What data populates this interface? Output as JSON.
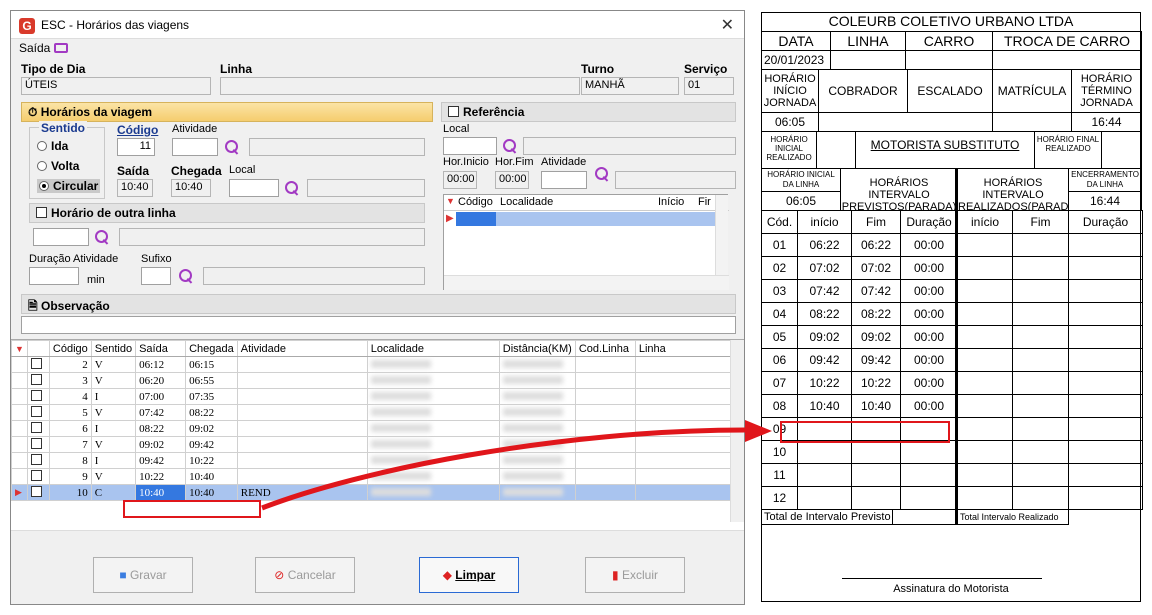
{
  "window": {
    "title": "ESC - Horários das viagens",
    "menu_label": "Saída",
    "close_glyph": "✕"
  },
  "header": {
    "tipo_dia_label": "Tipo de Dia",
    "tipo_dia_value": "ÚTEIS",
    "linha_label": "Linha",
    "linha_value": "",
    "turno_label": "Turno",
    "turno_value": "MANHÃ",
    "servico_label": "Serviço",
    "servico_value": "01"
  },
  "horarios": {
    "section_label": "Horários da viagem",
    "sentido_label": "Sentido",
    "options": [
      "Ida",
      "Volta",
      "Circular"
    ],
    "selected_option": "Circular",
    "codigo_label": "Código",
    "codigo_value": "11",
    "atividade_label": "Atividade",
    "saida_label": "Saída",
    "saida_value": "10:40",
    "chegada_label": "Chegada",
    "chegada_value": "10:40",
    "local_label": "Local"
  },
  "outra_linha": {
    "label": "Horário de outra linha",
    "duracao_label": "Duração Atividade",
    "min_label": "min",
    "sufixo_label": "Sufixo"
  },
  "referencia": {
    "label": "Referência",
    "local_label": "Local",
    "hor_inicio_label": "Hor.Inicio",
    "hor_inicio_value": "00:00",
    "hor_fim_label": "Hor.Fim",
    "hor_fim_value": "00:00",
    "atividade_label": "Atividade",
    "columns": [
      "Código",
      "Localidade",
      "Início",
      "Fir"
    ]
  },
  "observacao_label": "Observação",
  "grid": {
    "columns": [
      "Código",
      "Sentido",
      "Saída",
      "Chegada",
      "Atividade",
      "Localidade",
      "Distância(KM)",
      "Cod.Linha",
      "Linha"
    ],
    "rows": [
      {
        "codigo": "2",
        "sentido": "V",
        "saida": "06:12",
        "chegada": "06:15",
        "atividade": ""
      },
      {
        "codigo": "3",
        "sentido": "V",
        "saida": "06:20",
        "chegada": "06:55",
        "atividade": ""
      },
      {
        "codigo": "4",
        "sentido": "I",
        "saida": "07:00",
        "chegada": "07:35",
        "atividade": ""
      },
      {
        "codigo": "5",
        "sentido": "V",
        "saida": "07:42",
        "chegada": "08:22",
        "atividade": ""
      },
      {
        "codigo": "6",
        "sentido": "I",
        "saida": "08:22",
        "chegada": "09:02",
        "atividade": ""
      },
      {
        "codigo": "7",
        "sentido": "V",
        "saida": "09:02",
        "chegada": "09:42",
        "atividade": ""
      },
      {
        "codigo": "8",
        "sentido": "I",
        "saida": "09:42",
        "chegada": "10:22",
        "atividade": ""
      },
      {
        "codigo": "9",
        "sentido": "V",
        "saida": "10:22",
        "chegada": "10:40",
        "atividade": ""
      },
      {
        "codigo": "10",
        "sentido": "C",
        "saida": "10:40",
        "chegada": "10:40",
        "atividade": "REND"
      }
    ]
  },
  "buttons": {
    "gravar": "Gravar",
    "cancelar": "Cancelar",
    "limpar": "Limpar",
    "excluir": "Excluir"
  },
  "form": {
    "company": "COLEURB COLETIVO URBANO LTDA",
    "data_label": "DATA",
    "linha_label": "LINHA",
    "carro_label": "CARRO",
    "troca_label": "TROCA DE CARRO",
    "date_value": "20/01/2023",
    "horario_inicio_label": "HORÁRIO INÍCIO JORNADA",
    "cobrador_label": "COBRADOR",
    "escalado_label": "ESCALADO",
    "matricula_label": "MATRÍCULA",
    "horario_termino_label": "HORÁRIO TÉRMINO JORNADA",
    "inicio_value": "06:05",
    "termino_value": "16:44",
    "horario_inicial_realizado": "HORÁRIO INICIAL REALIZADO",
    "motorista_substituto": "MOTORISTA SUBSTITUTO",
    "horario_final_realizado": "HORÁRIO FINAL REALIZADO",
    "horario_inicial_linha": "HORÁRIO INICIAL DA LINHA",
    "inicial_linha_value": "06:05",
    "intervalos_previstos": "HORÁRIOS INTERVALO PREVISTOS(PARADA)",
    "intervalos_realizados": "HORÁRIOS INTERVALO REALIZADOS(PARADA)",
    "encerramento_label": "ENCERRAMENTO DA LINHA",
    "encerramento_value": "16:44",
    "cols": [
      "Cód.",
      "início",
      "Fim",
      "Duração",
      "início",
      "Fim",
      "Duração"
    ],
    "rows": [
      {
        "cod": "01",
        "inicio": "06:22",
        "fim": "06:22",
        "dur": "00:00"
      },
      {
        "cod": "02",
        "inicio": "07:02",
        "fim": "07:02",
        "dur": "00:00"
      },
      {
        "cod": "03",
        "inicio": "07:42",
        "fim": "07:42",
        "dur": "00:00"
      },
      {
        "cod": "04",
        "inicio": "08:22",
        "fim": "08:22",
        "dur": "00:00"
      },
      {
        "cod": "05",
        "inicio": "09:02",
        "fim": "09:02",
        "dur": "00:00"
      },
      {
        "cod": "06",
        "inicio": "09:42",
        "fim": "09:42",
        "dur": "00:00"
      },
      {
        "cod": "07",
        "inicio": "10:22",
        "fim": "10:22",
        "dur": "00:00"
      },
      {
        "cod": "08",
        "inicio": "10:40",
        "fim": "10:40",
        "dur": "00:00"
      },
      {
        "cod": "09",
        "inicio": "",
        "fim": "",
        "dur": ""
      },
      {
        "cod": "10",
        "inicio": "",
        "fim": "",
        "dur": ""
      },
      {
        "cod": "11",
        "inicio": "",
        "fim": "",
        "dur": ""
      },
      {
        "cod": "12",
        "inicio": "",
        "fim": "",
        "dur": ""
      }
    ],
    "total_previsto": "Total de Intervalo Previsto",
    "total_realizado": "Total Intervalo Realizado",
    "assinatura": "Assinatura do Motorista"
  },
  "colors": {
    "highlight": "#e0161b",
    "selection": "#a9c4ef",
    "section": "#f5cd6e"
  }
}
